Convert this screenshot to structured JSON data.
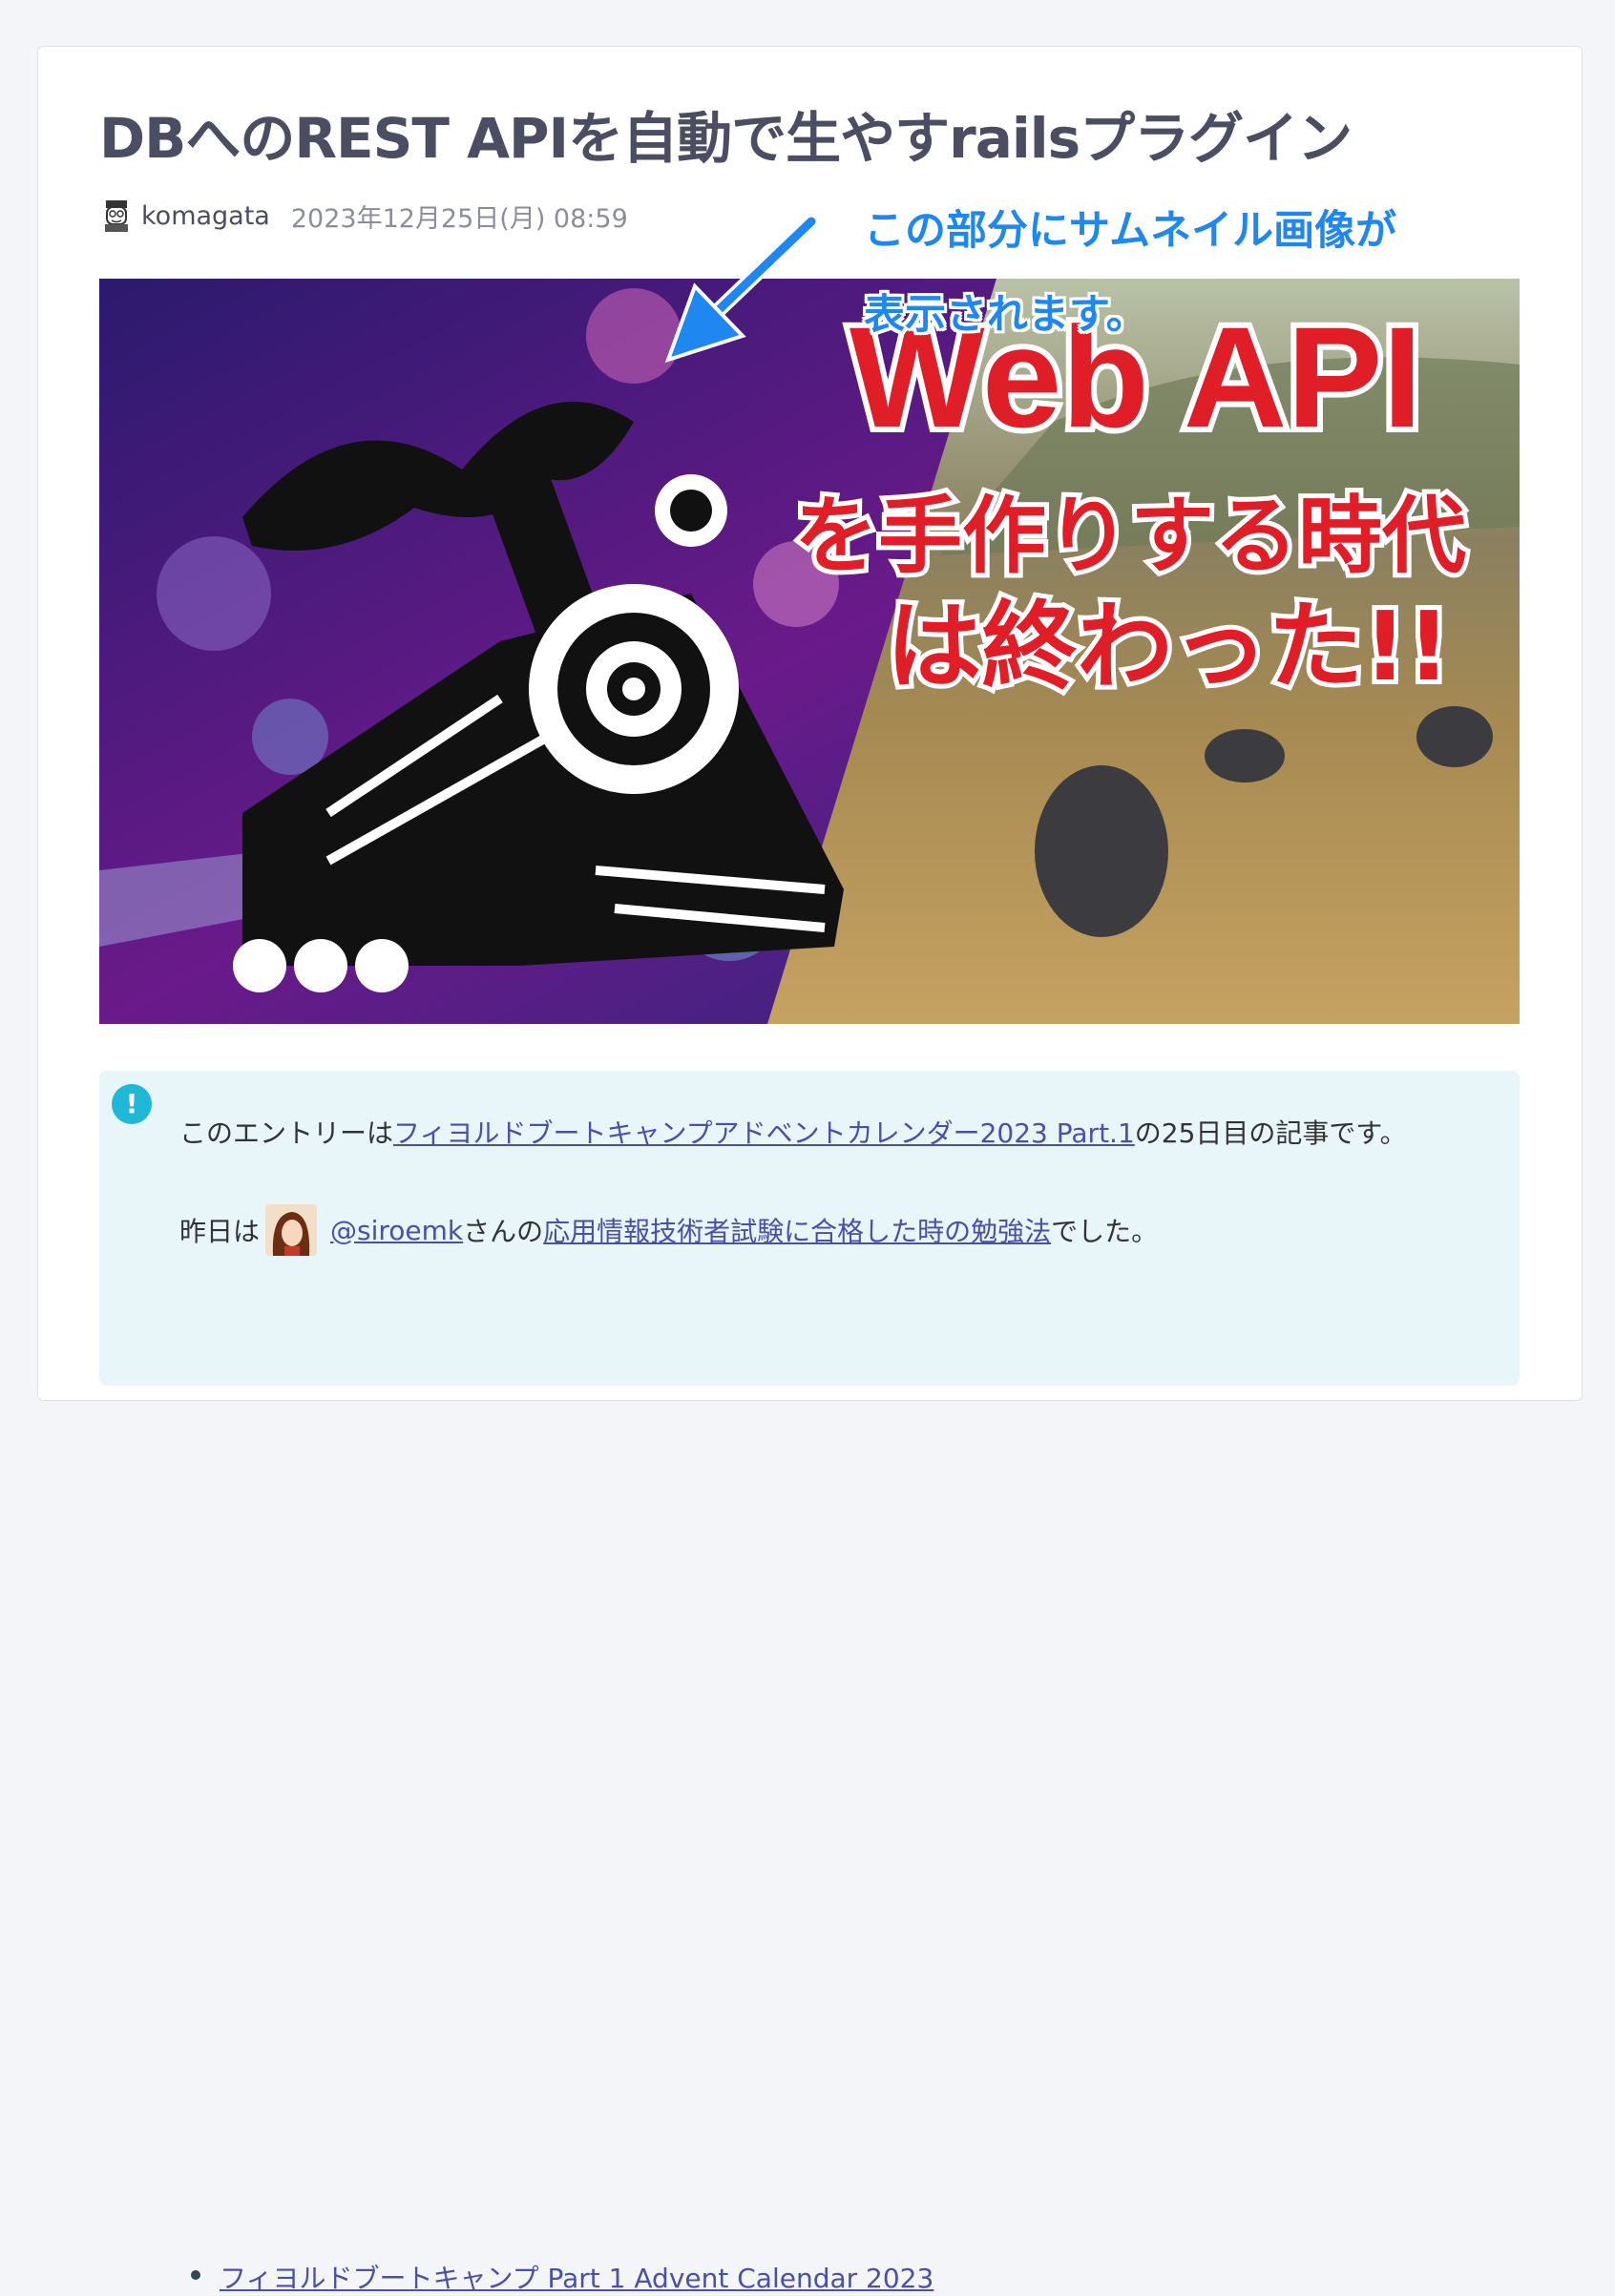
{
  "article": {
    "title": "DBへのREST APIを自動で生やすrailsプラグイン",
    "author": "komagata",
    "date": "2023年12月25日(月) 08:59"
  },
  "annotation": {
    "line1": "この部分にサムネイル画像が",
    "line2": "表示されます。"
  },
  "thumbnail": {
    "headline": "Web API",
    "line2": "を手作りする時代",
    "line3": "は終わった!!"
  },
  "note": {
    "p1_prefix": "このエントリーは",
    "p1_link": "フィヨルドブートキャンプアドベントカレンダー2023 Part.1",
    "p1_suffix": "の25日目の記事です。",
    "p2_prefix": "昨日は",
    "p2_user": "@siroemk",
    "p2_mid": "さんの",
    "p2_link": "応用情報技術者試験に合格した時の勉強法",
    "p2_suffix": "でした。",
    "list": [
      "フィヨルドブートキャンプ Part 1 Advent Calendar 2023"
    ]
  },
  "colors": {
    "accent_blue": "#1f87f0",
    "title": "#4b4d63",
    "note_bg": "#e8f6fa",
    "note_icon": "#1fb8d6",
    "link": "#4a4fa8"
  }
}
